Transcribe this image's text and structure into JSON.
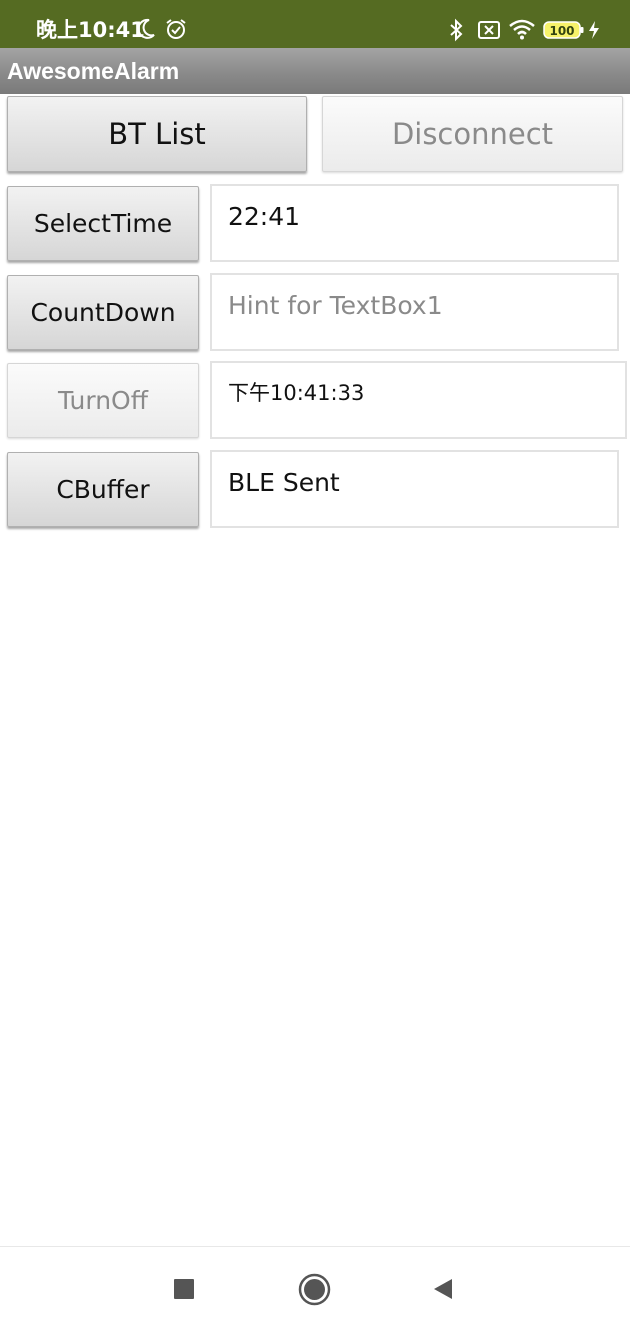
{
  "status_bar": {
    "time": "晚上10:41",
    "battery": "100",
    "icons": [
      "moon-icon",
      "alarm-icon",
      "bluetooth-icon",
      "sim-card-x-icon",
      "wifi-icon",
      "battery-icon",
      "charging-icon"
    ]
  },
  "app": {
    "title": "AwesomeAlarm"
  },
  "buttons": {
    "bt_list": "BT List",
    "disconnect": "Disconnect",
    "select_time": "SelectTime",
    "count_down": "CountDown",
    "turn_off": "TurnOff",
    "cbuffer": "CBuffer"
  },
  "textboxes": {
    "select_time_value": "22:41",
    "countdown_placeholder": "Hint for TextBox1",
    "turnoff_value": "下午10:41:33",
    "cbuffer_value": "BLE Sent"
  },
  "navbar": {
    "icons": [
      "recents-square-icon",
      "home-circle-icon",
      "back-triangle-icon"
    ]
  },
  "colors": {
    "status_bar": "#556b22",
    "title_bar": "#8a8a8a"
  }
}
